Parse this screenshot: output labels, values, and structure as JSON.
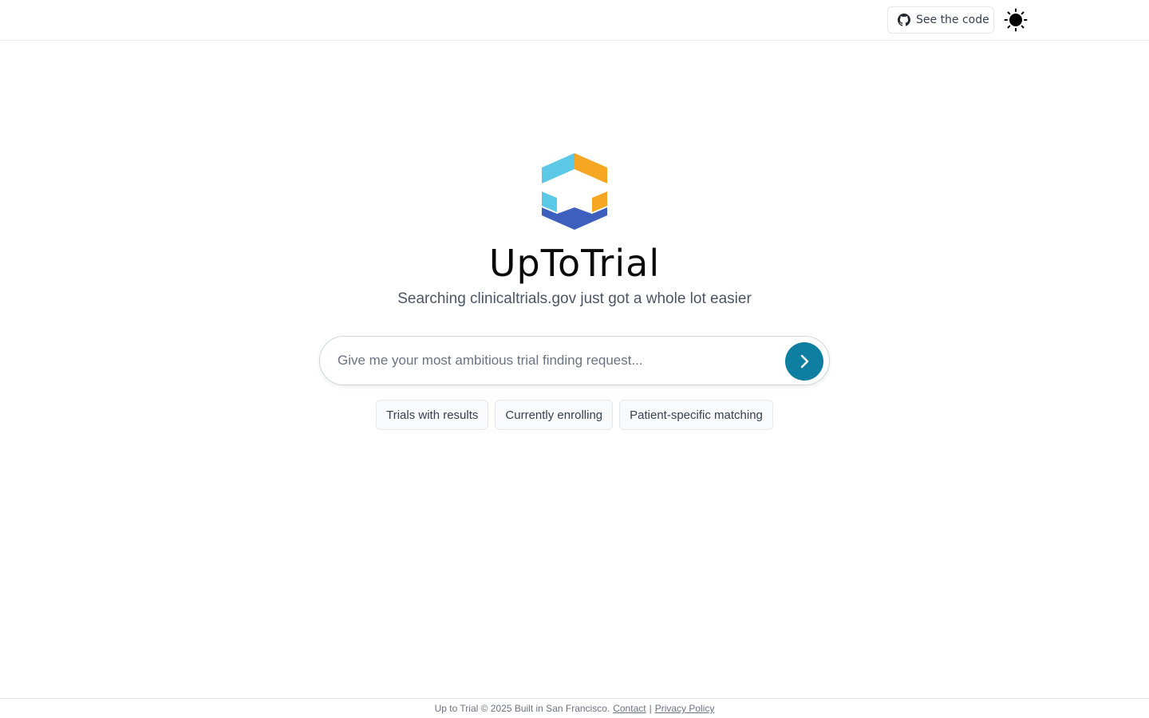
{
  "header": {
    "code_button_label": "See the code",
    "code_button_icon": "github-icon",
    "theme_toggle_icon": "sun-icon"
  },
  "hero": {
    "logo_icon": "uptotrial-logo",
    "title": "UpToTrial",
    "tagline": "Searching clinicaltrials.gov just got a whole lot easier"
  },
  "search": {
    "placeholder": "Give me your most ambitious trial finding request...",
    "value": "",
    "submit_icon": "chevron-right-icon"
  },
  "suggestions": [
    {
      "label": "Trials with results"
    },
    {
      "label": "Currently enrolling"
    },
    {
      "label": "Patient-specific matching"
    }
  ],
  "footer": {
    "text": "Up to Trial © 2025 Built in San Francisco.",
    "contact_label": "Contact",
    "separator": "|",
    "privacy_label": "Privacy Policy"
  },
  "colors": {
    "accent": "#0e7fa0",
    "logo_cyan": "#5bc8e8",
    "logo_orange": "#f5a623",
    "logo_blue": "#3f5fbf"
  }
}
